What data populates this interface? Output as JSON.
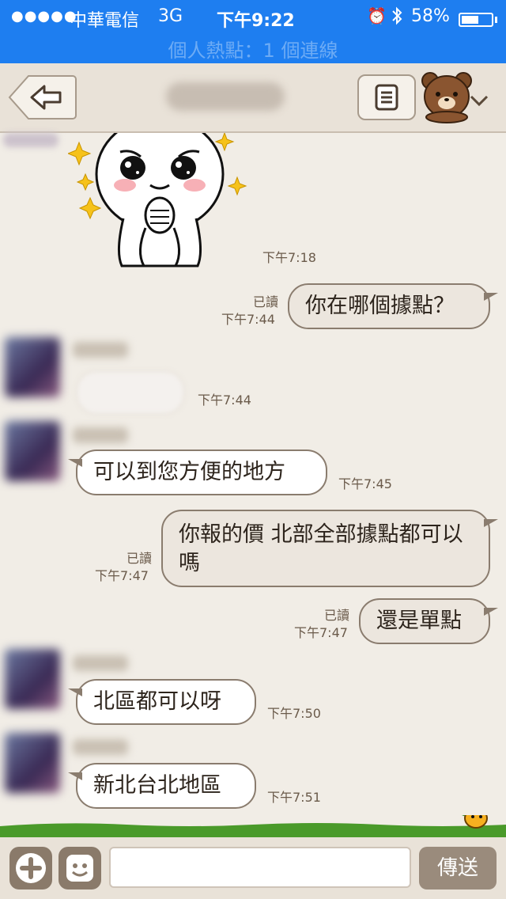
{
  "status_bar": {
    "signal": "●●●●●",
    "carrier": "中華電信",
    "network": "3G",
    "time": "下午9:22",
    "battery": "58%",
    "battery_level": 0.58,
    "hotspot": "個人熱點：1 個連線"
  },
  "header": {
    "title": "",
    "back_icon": "back-arrow-icon",
    "menu_icon": "list-icon"
  },
  "messages": {
    "m1": {
      "time": "下午7:18"
    },
    "m2": {
      "read": "已讀",
      "time": "下午7:44",
      "text": "你在哪個據點？"
    },
    "m3": {
      "time": "下午7:44"
    },
    "m4": {
      "time": "下午7:45",
      "text": "可以到您方便的地方"
    },
    "m5": {
      "read": "已讀",
      "time": "下午7:47",
      "text": "你報的價 北部全部據點都可以嗎"
    },
    "m6": {
      "read": "已讀",
      "time": "下午7:47",
      "text": "還是單點"
    },
    "m7": {
      "time": "下午7:50",
      "text": "北區都可以呀"
    },
    "m8": {
      "time": "下午7:51",
      "text": "新北台北地區"
    }
  },
  "input_bar": {
    "placeholder": "",
    "send_label": "傳送"
  },
  "colors": {
    "status_bar": "#1e7ef0",
    "background": "#f1ede6",
    "header": "#e9e2d8"
  }
}
